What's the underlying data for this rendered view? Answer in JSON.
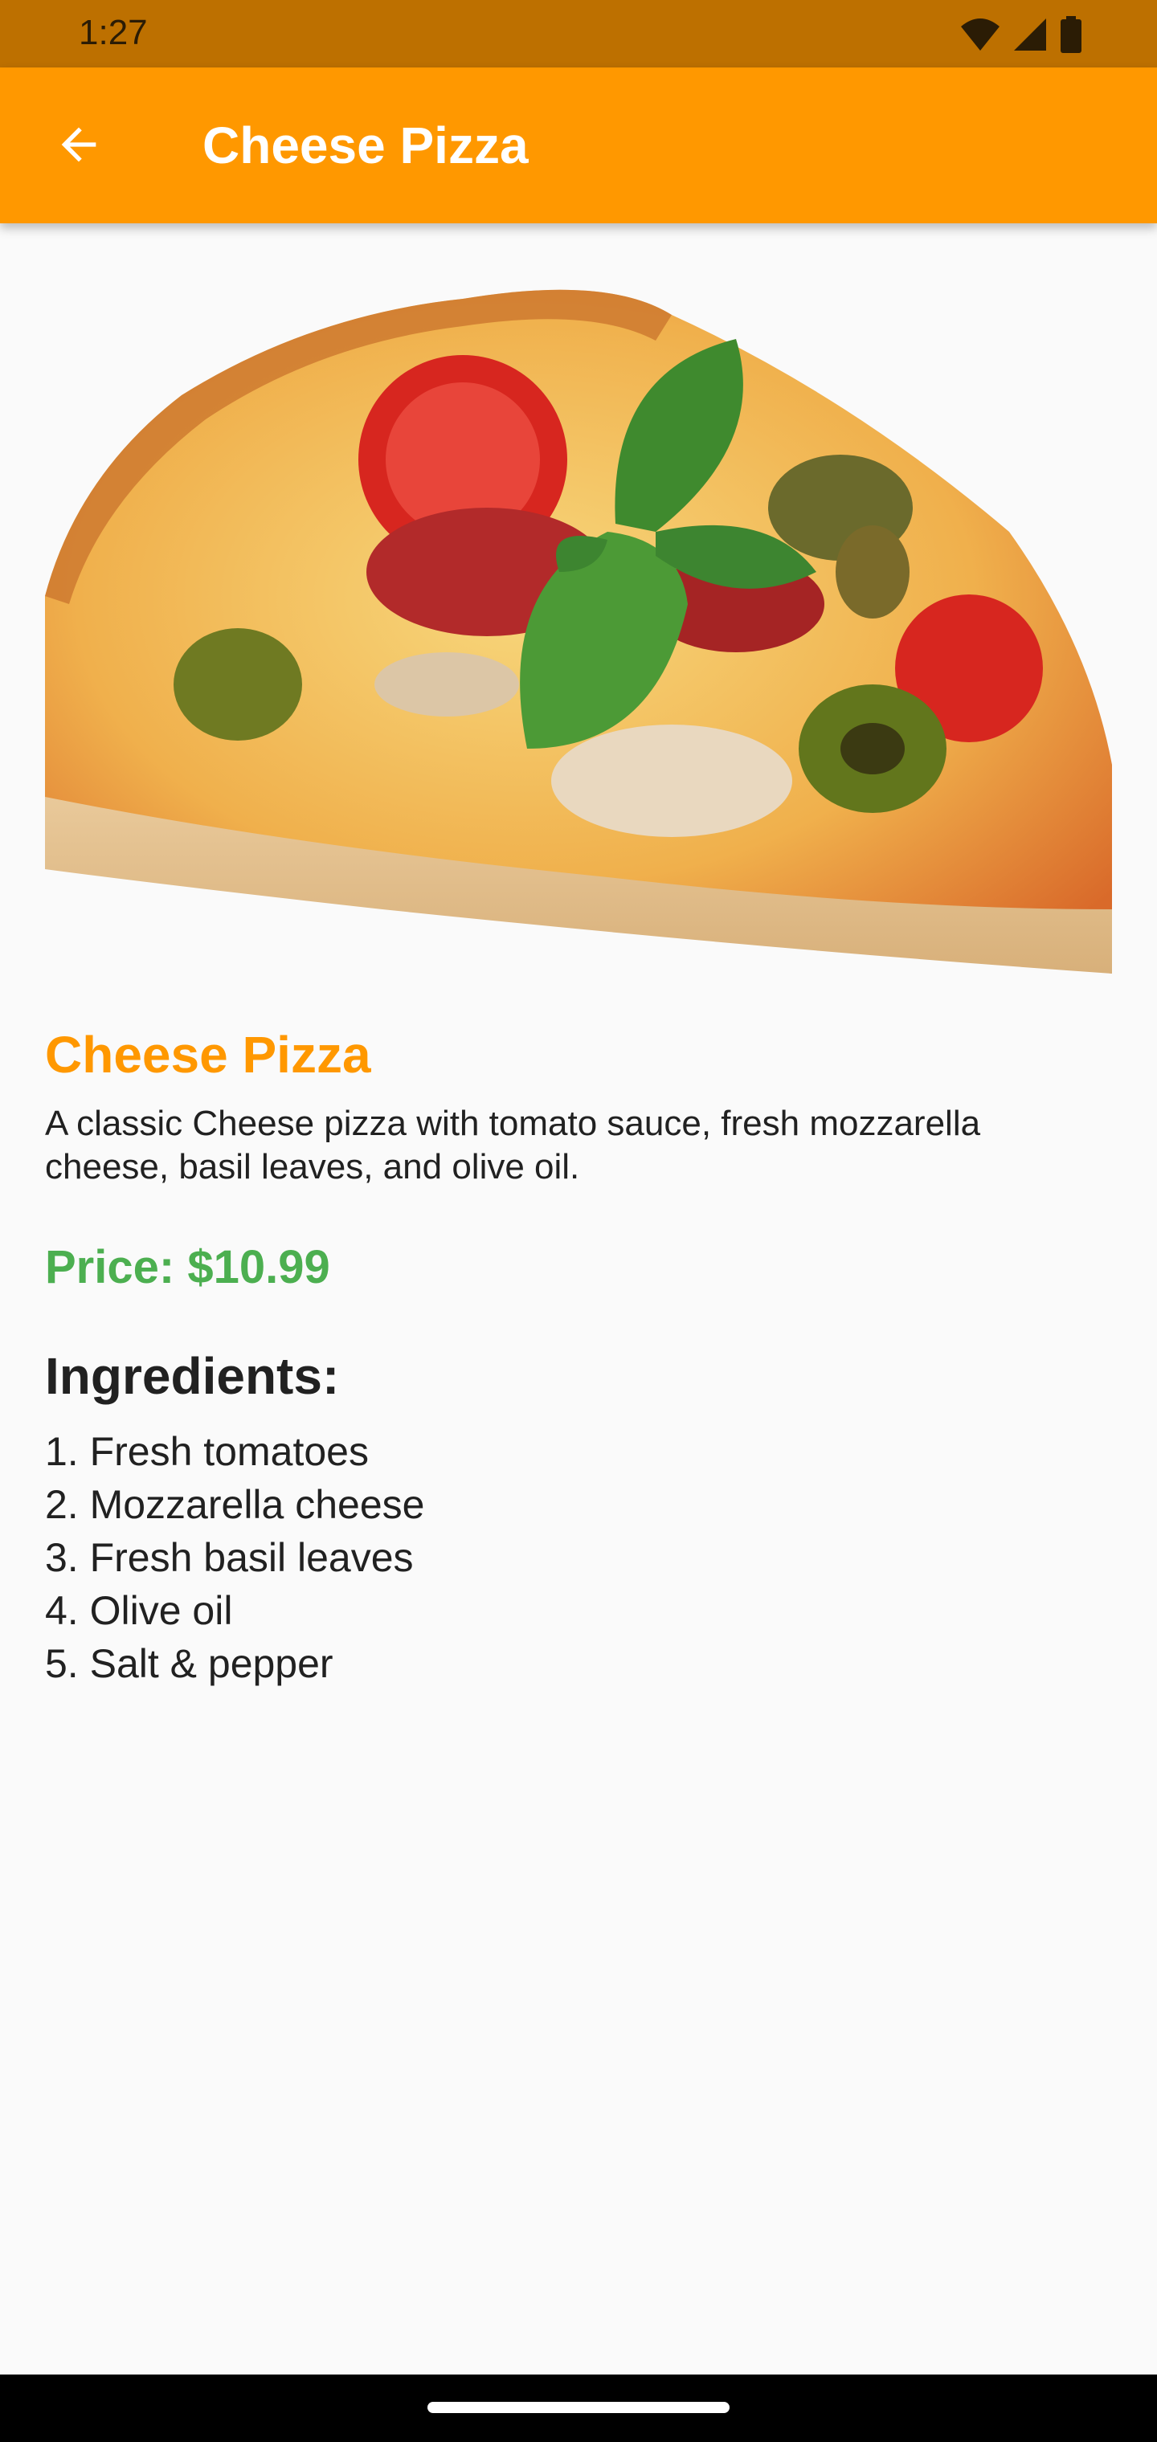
{
  "status": {
    "time": "1:27"
  },
  "app_bar": {
    "title": "Cheese Pizza"
  },
  "pizza": {
    "title": "Cheese Pizza",
    "description": "A classic Cheese pizza with tomato sauce, fresh mozzarella cheese, basil leaves, and olive oil.",
    "price": "Price: $10.99",
    "ingredients_title": "Ingredients:",
    "ingredients": [
      "1. Fresh tomatoes",
      "2. Mozzarella cheese",
      "3. Fresh basil leaves",
      "4. Olive oil",
      "5. Salt & pepper"
    ]
  },
  "colors": {
    "primary": "#ff9800",
    "status": "#bd7000",
    "price": "#4caf50"
  }
}
